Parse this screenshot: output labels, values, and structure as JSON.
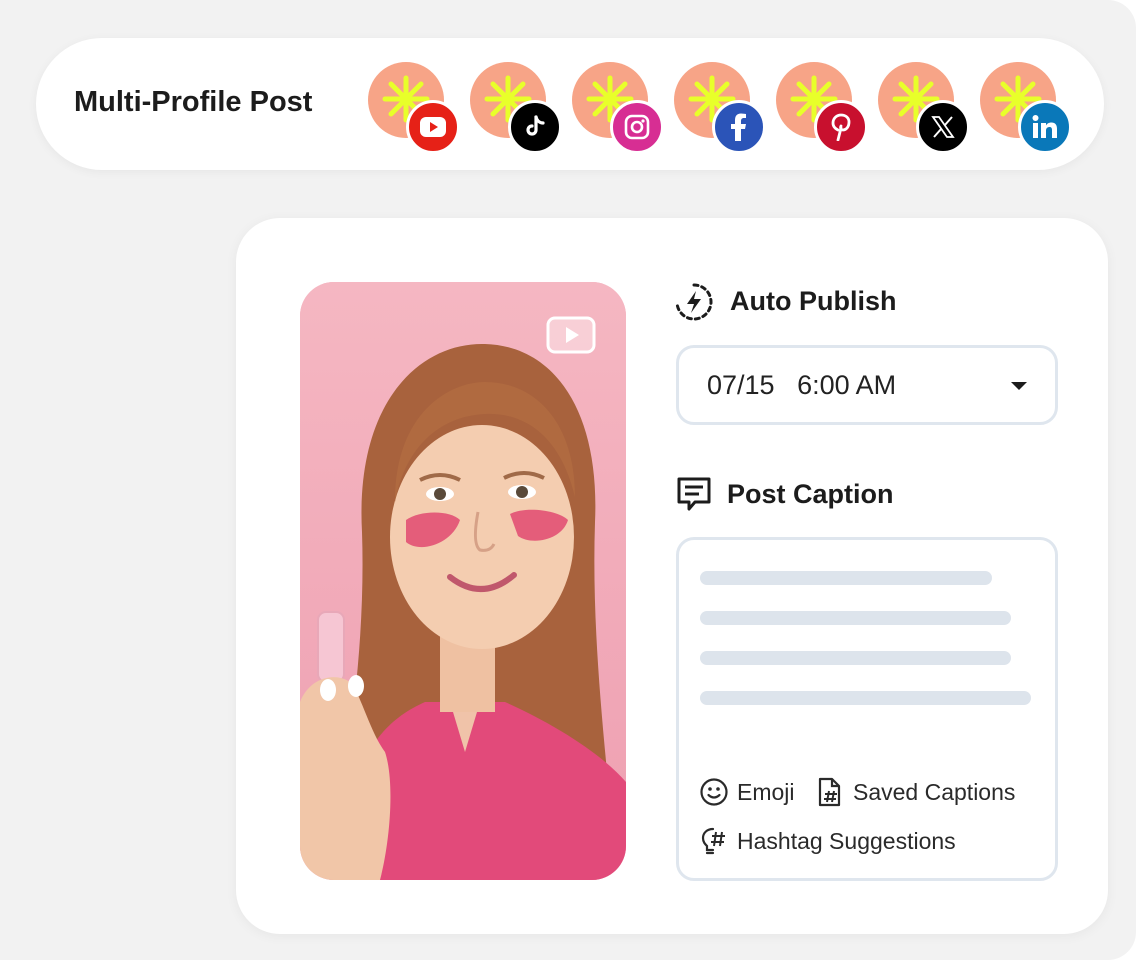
{
  "header": {
    "title": "Multi-Profile Post",
    "profiles": [
      {
        "network": "YouTube",
        "icon": "youtube-icon",
        "color": "#e62117"
      },
      {
        "network": "TikTok",
        "icon": "tiktok-icon",
        "color": "#000000"
      },
      {
        "network": "Instagram",
        "icon": "instagram-icon",
        "color": "#d72e93"
      },
      {
        "network": "Facebook",
        "icon": "facebook-icon",
        "color": "#2b54b8"
      },
      {
        "network": "Pinterest",
        "icon": "pinterest-icon",
        "color": "#c8102e"
      },
      {
        "network": "X",
        "icon": "x-icon",
        "color": "#000000"
      },
      {
        "network": "LinkedIn",
        "icon": "linkedin-icon",
        "color": "#0a78b9"
      }
    ],
    "avatar_color": "#f7a487",
    "avatar_star_color": "#e8ff2a"
  },
  "post": {
    "media": {
      "type": "video",
      "icon": "video-play-icon"
    },
    "auto_publish": {
      "label": "Auto Publish",
      "icon": "lightning-clock-icon",
      "date": "07/15",
      "time": "6:00 AM",
      "display": "07/15   6:00 AM"
    },
    "caption": {
      "label": "Post Caption",
      "icon": "message-icon",
      "tools": [
        {
          "label": "Emoji",
          "icon": "emoji-icon"
        },
        {
          "label": "Saved Captions",
          "icon": "saved-captions-icon"
        },
        {
          "label": "Hashtag Suggestions",
          "icon": "hashtag-bulb-icon"
        }
      ]
    }
  },
  "colors": {
    "page_bg": "#f2f2f2",
    "card_bg": "#ffffff",
    "border": "#dfe6ee",
    "placeholder_line": "#dde4ec"
  }
}
